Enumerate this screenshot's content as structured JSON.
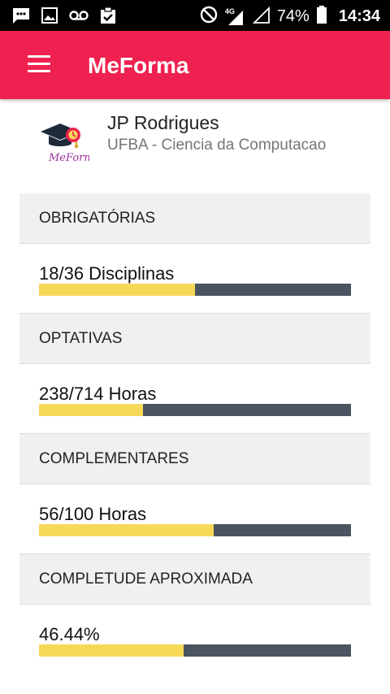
{
  "status_bar": {
    "network_label": "4G",
    "battery": "74%",
    "time": "14:34",
    "icons": [
      "chat-icon",
      "image-icon",
      "voicemail-icon",
      "clipboard-check-icon",
      "do-not-disturb-icon",
      "signal-icon",
      "signal-empty-icon",
      "battery-icon"
    ]
  },
  "app_bar": {
    "title": "MeForma",
    "menu_icon": "hamburger-menu-icon",
    "color": "#ef2150"
  },
  "profile": {
    "logo_text": "MeForm",
    "name": "JP Rodrigues",
    "course": "UFBA - Ciencia da Computacao"
  },
  "colors": {
    "progress_fill": "#f7d95a",
    "progress_track": "#4b5561",
    "header_bg": "#f0f0f0"
  },
  "sections": [
    {
      "title": "OBRIGATÓRIAS",
      "progress_text": "18/36 Disciplinas",
      "progress": 0.5
    },
    {
      "title": "OPTATIVAS",
      "progress_text": "238/714 Horas",
      "progress": 0.333
    },
    {
      "title": "COMPLEMENTARES",
      "progress_text": "56/100 Horas",
      "progress": 0.56
    },
    {
      "title": "COMPLETUDE APROXIMADA",
      "progress_text": "46.44%",
      "progress": 0.4644
    }
  ]
}
